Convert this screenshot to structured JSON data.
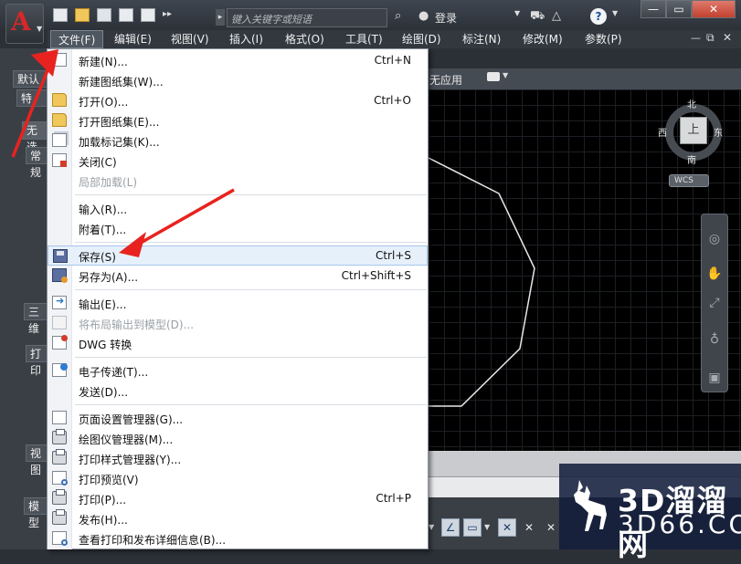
{
  "title_bar": {
    "app_logo": "A",
    "search_placeholder": "键入关键字或短语",
    "login_label": "登录",
    "help_label": "?",
    "window_buttons": {
      "minimize": "—",
      "restore": "▭",
      "close": "✕"
    },
    "doc_buttons": {
      "minimize": "—",
      "restore": "⧉",
      "close": "✕"
    }
  },
  "menu_bar": {
    "items": [
      "文件(F)",
      "编辑(E)",
      "视图(V)",
      "插入(I)",
      "格式(O)",
      "工具(T)",
      "绘图(D)",
      "标注(N)",
      "修改(M)",
      "参数(P)"
    ]
  },
  "side_panel": {
    "tabs": [
      "默认",
      "特",
      "无选",
      "常规",
      "三维",
      "打印",
      "视图",
      "模型"
    ]
  },
  "workspace": {
    "label": "无应用"
  },
  "viewcube": {
    "north": "北",
    "south": "南",
    "west": "西",
    "east": "东",
    "face": "上",
    "wcs": "WCS"
  },
  "file_menu": {
    "groups": [
      [
        {
          "label": "新建(N)...",
          "shortcut": "Ctrl+N",
          "icon": "new-page-icon",
          "enabled": true
        },
        {
          "label": "新建图纸集(W)...",
          "shortcut": "",
          "icon": "new-sheet-set-icon",
          "enabled": true
        },
        {
          "label": "打开(O)...",
          "shortcut": "Ctrl+O",
          "icon": "open-folder-icon",
          "enabled": true
        },
        {
          "label": "打开图纸集(E)...",
          "shortcut": "",
          "icon": "open-sheet-set-icon",
          "enabled": true
        },
        {
          "label": "加载标记集(K)...",
          "shortcut": "",
          "icon": "markup-set-icon",
          "enabled": true
        },
        {
          "label": "关闭(C)",
          "shortcut": "",
          "icon": "close-file-icon",
          "enabled": true
        },
        {
          "label": "局部加载(L)",
          "shortcut": "",
          "icon": "",
          "enabled": false
        }
      ],
      [
        {
          "label": "输入(R)...",
          "shortcut": "",
          "icon": "",
          "enabled": true
        },
        {
          "label": "附着(T)...",
          "shortcut": "",
          "icon": "",
          "enabled": true
        }
      ],
      [
        {
          "label": "保存(S)",
          "shortcut": "Ctrl+S",
          "icon": "save-disk-icon",
          "enabled": true,
          "highlighted": true
        },
        {
          "label": "另存为(A)...",
          "shortcut": "Ctrl+Shift+S",
          "icon": "save-as-icon",
          "enabled": true
        }
      ],
      [
        {
          "label": "输出(E)...",
          "shortcut": "",
          "icon": "export-icon",
          "enabled": true
        },
        {
          "label": "将布局输出到模型(D)...",
          "shortcut": "",
          "icon": "layout-export-icon",
          "enabled": false
        },
        {
          "label": "DWG 转换",
          "shortcut": "",
          "icon": "dwg-convert-icon",
          "enabled": true
        }
      ],
      [
        {
          "label": "电子传递(T)...",
          "shortcut": "",
          "icon": "etransmit-icon",
          "enabled": true
        },
        {
          "label": "发送(D)...",
          "shortcut": "",
          "icon": "",
          "enabled": true
        }
      ],
      [
        {
          "label": "页面设置管理器(G)...",
          "shortcut": "",
          "icon": "page-setup-icon",
          "enabled": true
        },
        {
          "label": "绘图仪管理器(M)...",
          "shortcut": "",
          "icon": "plotter-manager-icon",
          "enabled": true
        },
        {
          "label": "打印样式管理器(Y)...",
          "shortcut": "",
          "icon": "plot-style-icon",
          "enabled": true
        },
        {
          "label": "打印预览(V)",
          "shortcut": "",
          "icon": "plot-preview-icon",
          "enabled": true
        },
        {
          "label": "打印(P)...",
          "shortcut": "Ctrl+P",
          "icon": "printer-icon",
          "enabled": true
        },
        {
          "label": "发布(H)...",
          "shortcut": "",
          "icon": "publish-icon",
          "enabled": true
        },
        {
          "label": "查看打印和发布详细信息(B)...",
          "shortcut": "",
          "icon": "plot-details-icon",
          "enabled": true
        }
      ]
    ]
  },
  "watermark": {
    "brand": "3D溜溜网",
    "site": "3D66.COM"
  },
  "colors": {
    "accent_red": "#d62828",
    "menu_highlight": "#e6f0fb",
    "canvas": "#000000"
  }
}
